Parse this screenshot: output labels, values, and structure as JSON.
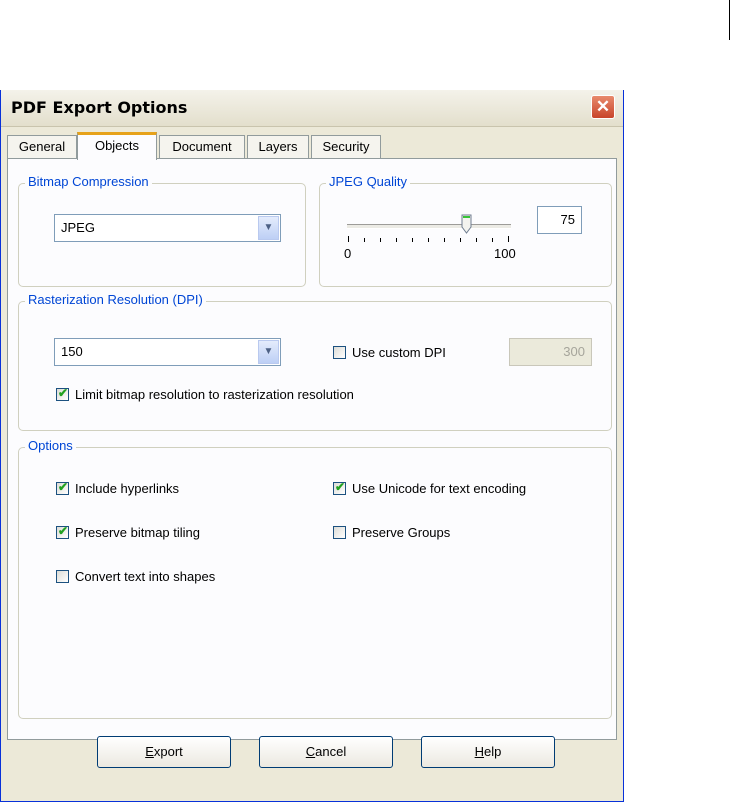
{
  "window": {
    "title": "PDF Export Options"
  },
  "tabs": [
    {
      "label": "General"
    },
    {
      "label": "Objects"
    },
    {
      "label": "Document"
    },
    {
      "label": "Layers"
    },
    {
      "label": "Security"
    }
  ],
  "active_tab": "Objects",
  "bitmap_compression": {
    "label": "Bitmap Compression",
    "value": "JPEG"
  },
  "jpeg_quality": {
    "label": "JPEG Quality",
    "value": "75",
    "min": "0",
    "max": "100"
  },
  "rasterization": {
    "label": "Rasterization Resolution (DPI)",
    "value": "150",
    "custom_dpi": {
      "label": "Use custom DPI",
      "checked": false
    },
    "custom_dpi_value": "300",
    "limit": {
      "label": "Limit bitmap resolution to rasterization resolution",
      "checked": true
    }
  },
  "options": {
    "label": "Options",
    "include_hyperlinks": {
      "label": "Include hyperlinks",
      "checked": true
    },
    "use_unicode": {
      "label": "Use Unicode for text encoding",
      "checked": true
    },
    "preserve_tiling": {
      "label": "Preserve bitmap tiling",
      "checked": true
    },
    "preserve_groups": {
      "label": "Preserve Groups",
      "checked": false
    },
    "convert_text": {
      "label": "Convert text into shapes",
      "checked": false
    }
  },
  "buttons": {
    "export": {
      "accel": "E",
      "rest": "xport"
    },
    "cancel": {
      "accel": "C",
      "rest": "ancel"
    },
    "help": {
      "accel": "H",
      "rest": "elp"
    }
  },
  "icons": {
    "close": "close-icon",
    "dropdown": "chevron-down-icon",
    "check": "checkmark-icon"
  },
  "colors": {
    "group_label": "#0046d5",
    "active_tab_accent": "#e6a21a",
    "close_button": "#c8442a",
    "checkmark": "#21a121"
  }
}
